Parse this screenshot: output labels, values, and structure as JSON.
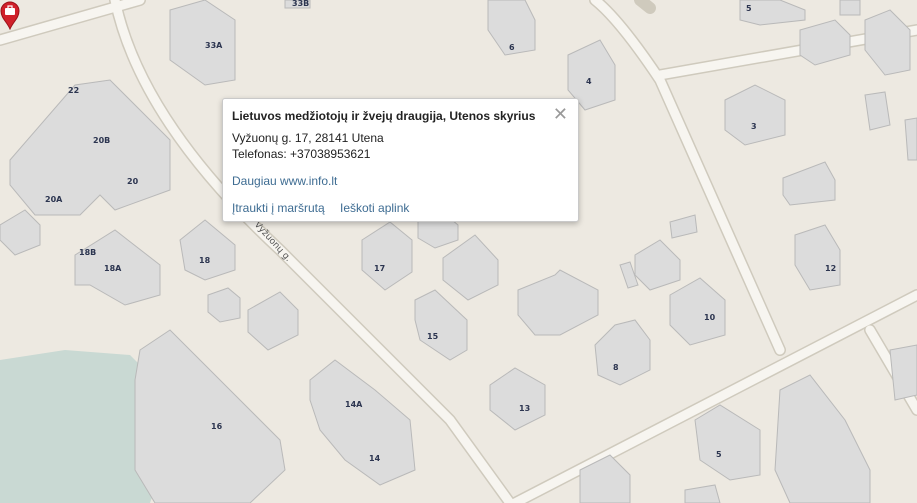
{
  "popup": {
    "title": "Lietuvos medžiotojų ir žvejų draugija, Utenos skyrius",
    "address": "Vyžuonų g. 17, 28141 Utena",
    "phone": "Telefonas: +37038953621",
    "more_link": "Daugiau www.info.lt",
    "route_link": "Įtraukti į maršrutą",
    "nearby_link": "Ieškoti aplink",
    "close_icon": "close-icon"
  },
  "map": {
    "street_label": "Vyžuonų g.",
    "building_numbers": {
      "b33b": "33B",
      "b33a": "33A",
      "b22": "22",
      "b20b": "20B",
      "b20": "20",
      "b20a": "20A",
      "b18b": "18B",
      "b18a": "18A",
      "b18": "18",
      "b16": "16",
      "b14a": "14A",
      "b14": "14",
      "b17": "17",
      "b15": "15",
      "b13": "13",
      "b8": "8",
      "b10": "10",
      "b12": "12",
      "b6": "6",
      "b4": "4",
      "b3": "3",
      "b5": "5",
      "b5b": "5"
    },
    "marker_icon": "briefcase-marker-icon",
    "colors": {
      "background": "#ede9e1",
      "road": "#f7f5f0",
      "water": "#c9d9d3",
      "building": "#d9d9d9",
      "marker": "#d0202a"
    }
  }
}
